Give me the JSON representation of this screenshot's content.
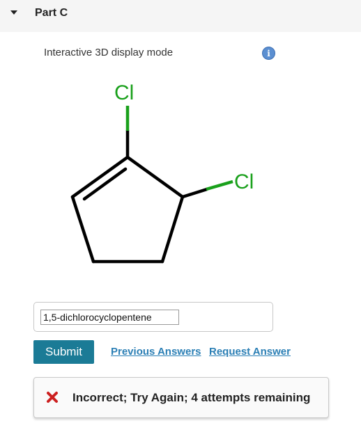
{
  "part": {
    "title": "Part C"
  },
  "viewer": {
    "mode_label": "Interactive 3D display mode",
    "info_glyph": "i"
  },
  "molecule": {
    "atoms": [
      {
        "element": "Cl",
        "color": "#19a01b"
      },
      {
        "element": "Cl",
        "color": "#19a01b"
      }
    ],
    "bond_color": "#000000"
  },
  "answer": {
    "value": "1,5-dichlorocyclopentene"
  },
  "actions": {
    "submit_label": "Submit",
    "previous_answers_label": "Previous Answers",
    "request_answer_label": "Request Answer"
  },
  "feedback": {
    "message": "Incorrect; Try Again; 4 attempts remaining",
    "icon": "x-icon",
    "icon_color": "#cc1f1f"
  },
  "colors": {
    "submit_bg": "#1b7b96",
    "link": "#2b7fb5",
    "header_bg": "#f5f5f5",
    "info_icon": "#5b8fd1"
  }
}
